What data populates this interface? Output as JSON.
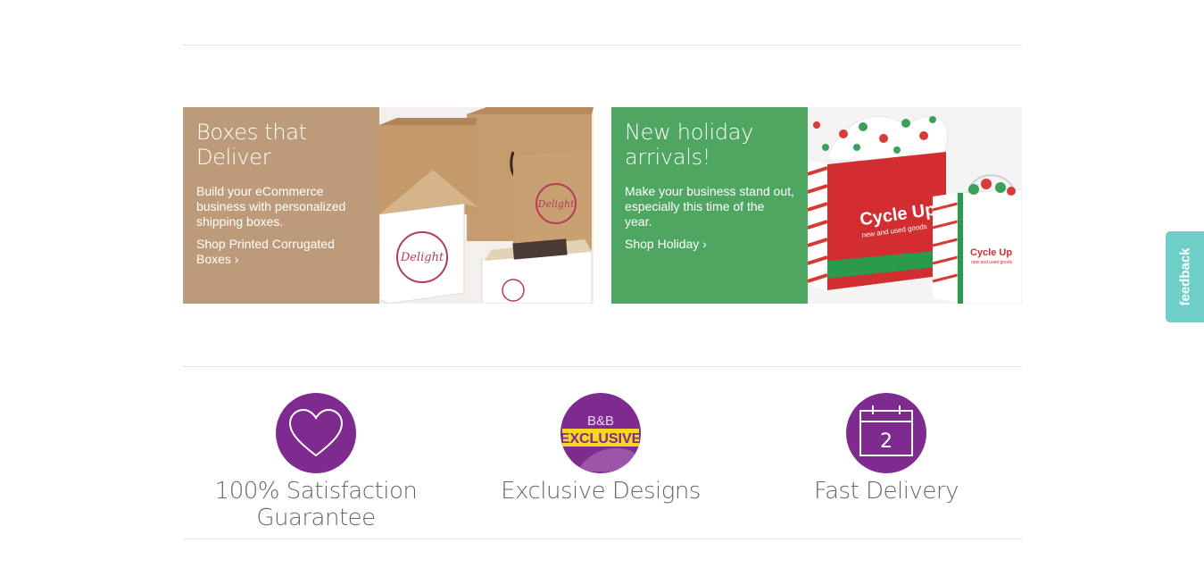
{
  "promos": [
    {
      "title": "Boxes that Deliver",
      "description": "Build your eCommerce business with personalized shipping boxes.",
      "link_label": "Shop Printed Corrugated Boxes ›",
      "panel_color": "#bd9b7a",
      "box_stamp_text": "Delight"
    },
    {
      "title": "New holiday arrivals!",
      "description": "Make your business stand out, especially this time of the year.",
      "link_label": "Shop Holiday ›",
      "panel_color": "#4fa661",
      "bag_brand": "Cycle Up",
      "bag_tagline": "new and used goods"
    }
  ],
  "features": [
    {
      "label": "100% Satisfaction Guarantee",
      "icon": "heart-icon"
    },
    {
      "label": "Exclusive Designs",
      "icon": "exclusive-badge-icon",
      "badge_top": "B&B",
      "badge_main": "EXCLUSIVE"
    },
    {
      "label": "Fast Delivery",
      "icon": "calendar-icon",
      "calendar_number": "2"
    }
  ],
  "feedback": {
    "label": "feedback"
  },
  "colors": {
    "accent_purple": "#7e2a8f",
    "feedback_teal": "#6ecec8",
    "divider": "#e3e3e3"
  }
}
